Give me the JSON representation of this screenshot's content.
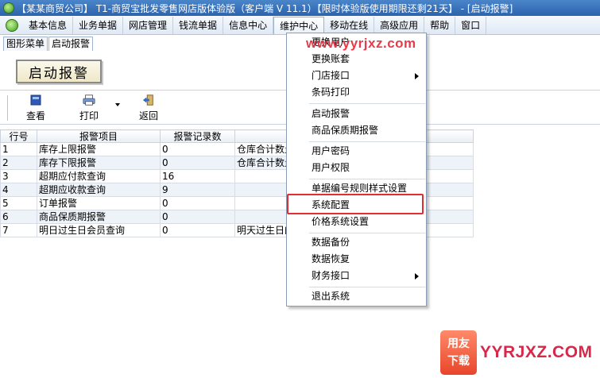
{
  "window": {
    "title": "【某某商贸公司】 T1-商贸宝批发零售网店版体验版（客户端 V 11.1）【限时体验版使用期限还剩21天】 - [启动报警]"
  },
  "menubar": {
    "items": [
      "基本信息",
      "业务单据",
      "网店管理",
      "钱流单据",
      "信息中心",
      "维护中心",
      "移动在线",
      "高级应用",
      "帮助",
      "窗口"
    ],
    "active": "维护中心"
  },
  "tabs": [
    {
      "label": "图形菜单",
      "active": false
    },
    {
      "label": "启动报警",
      "active": true
    }
  ],
  "banner": {
    "label": "启动报警"
  },
  "toolbar": {
    "view_label": "查看",
    "print_label": "打印",
    "back_label": "返回"
  },
  "table": {
    "headers": [
      "行号",
      "报警项目",
      "报警记录数",
      ""
    ],
    "rows": [
      [
        "1",
        "库存上限报警",
        "0",
        "仓库合计数量"
      ],
      [
        "2",
        "库存下限报警",
        "0",
        "仓库合计数量"
      ],
      [
        "3",
        "超期应付款查询",
        "16",
        ""
      ],
      [
        "4",
        "超期应收款查询",
        "9",
        ""
      ],
      [
        "5",
        "订单报警",
        "0",
        ""
      ],
      [
        "6",
        "商品保质期报警",
        "0",
        ""
      ],
      [
        "7",
        "明日过生日会员查询",
        "0",
        "明天过生日的"
      ]
    ]
  },
  "dropdown": {
    "items": [
      {
        "label": "更换用户",
        "submenu": false
      },
      {
        "label": "更换账套",
        "submenu": false
      },
      {
        "label": "门店接口",
        "submenu": true
      },
      {
        "label": "条码打印",
        "submenu": false
      },
      {
        "label": "启动报警",
        "submenu": false
      },
      {
        "label": "商品保质期报警",
        "submenu": false
      },
      {
        "label": "用户密码",
        "submenu": false
      },
      {
        "label": "用户权限",
        "submenu": false
      },
      {
        "label": "单据编号规则样式设置",
        "submenu": false
      },
      {
        "label": "系统配置",
        "submenu": false,
        "highlighted": true
      },
      {
        "label": "价格系统设置",
        "submenu": false
      },
      {
        "label": "数据备份",
        "submenu": false
      },
      {
        "label": "数据恢复",
        "submenu": false
      },
      {
        "label": "财务接口",
        "submenu": true
      },
      {
        "label": "退出系统",
        "submenu": false
      }
    ]
  },
  "watermark": {
    "text": "www.yyrjxz.com"
  },
  "corner_logo": {
    "line1": "用友",
    "line2": "下载",
    "text": "YYRJXZ.COM"
  },
  "colors": {
    "highlight": "#e0302b",
    "watermark": "#e53b4b",
    "titlebar": "#2c63ad"
  }
}
